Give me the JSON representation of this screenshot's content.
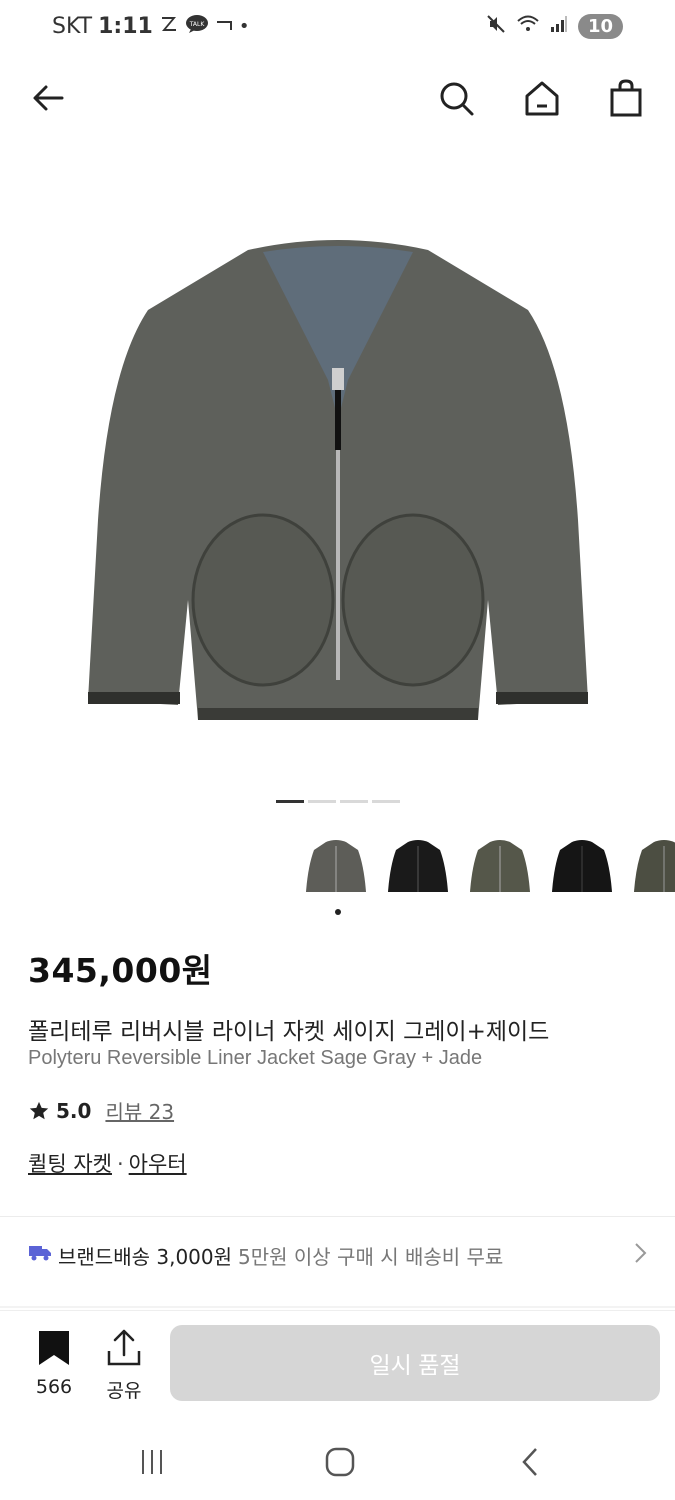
{
  "status_bar": {
    "carrier": "SKT",
    "time": "1:11",
    "battery": "10"
  },
  "nav": {
    "icons": [
      "back-arrow-icon",
      "search-icon",
      "home-icon",
      "shopping-bag-icon"
    ]
  },
  "gallery": {
    "page_count": 4,
    "active_index": 0,
    "thumbnails": [
      {
        "color": "#5d5d58"
      },
      {
        "color": "#1a1a1a"
      },
      {
        "color": "#55574a"
      },
      {
        "color": "#151515"
      },
      {
        "color": "#4c4e42"
      }
    ]
  },
  "product": {
    "price": "345,000원",
    "name_ko": "폴리테루 리버시블 라이너 자켓 세이지 그레이+제이드",
    "name_en": "Polyteru Reversible Liner Jacket Sage Gray + Jade",
    "rating": "5.0",
    "reviews_label": "리뷰 23",
    "categories": [
      "퀼팅 자켓",
      "아우터"
    ],
    "category_separator": "·"
  },
  "shipping": {
    "label": "브랜드배송 3,000원",
    "note": "5만원 이상 구매 시 배송비 무료"
  },
  "bottom_bar": {
    "bookmark_count": "566",
    "share_label": "공유",
    "soldout_label": "일시 품절"
  },
  "colors": {
    "accent_truck": "#5b63d6",
    "soldout_bg": "#d6d6d6"
  }
}
